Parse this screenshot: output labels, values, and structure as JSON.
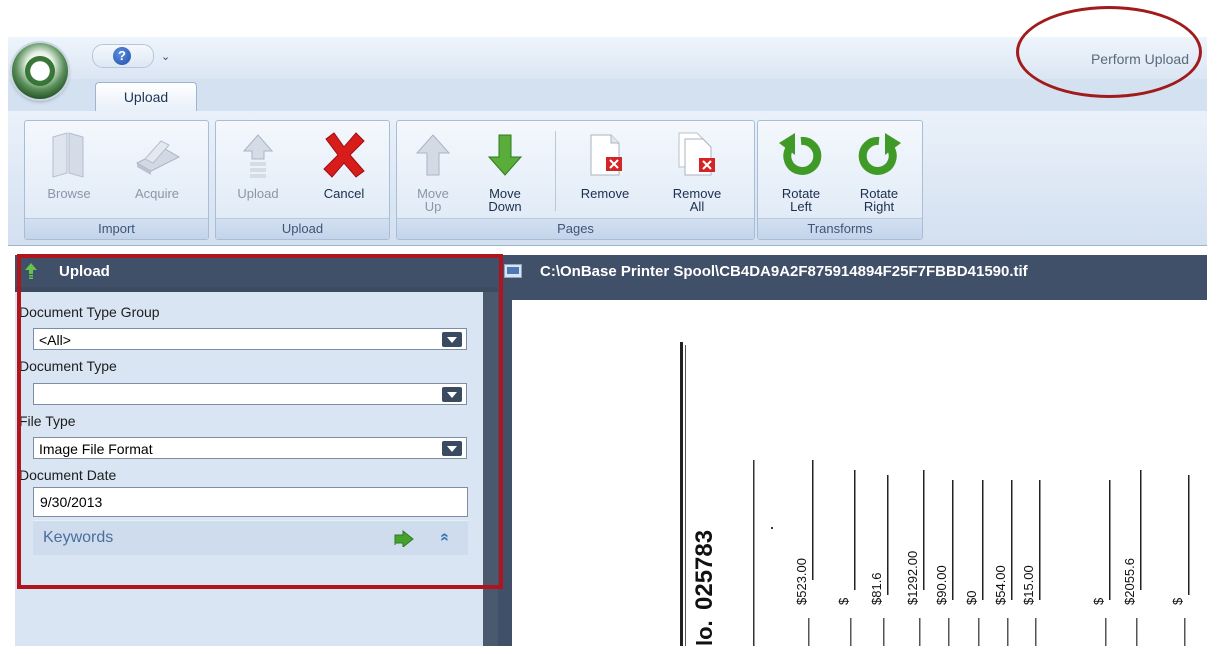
{
  "window": {
    "right_title": "Perform Upload"
  },
  "quick_access": {
    "menu_glyph": "⌄"
  },
  "tabs": [
    {
      "label": "Upload",
      "active": true
    }
  ],
  "ribbon": {
    "groups": [
      {
        "label": "Import",
        "buttons": [
          {
            "label": "Browse",
            "enabled": false,
            "icon": "browse-icon"
          },
          {
            "label": "Acquire",
            "enabled": false,
            "icon": "scanner-icon"
          }
        ]
      },
      {
        "label": "Upload",
        "buttons": [
          {
            "label": "Upload",
            "enabled": false,
            "icon": "upload-arrow-icon"
          },
          {
            "label": "Cancel",
            "enabled": true,
            "icon": "red-x-icon"
          }
        ]
      },
      {
        "label": "Pages",
        "buttons": [
          {
            "label": "Move\nUp",
            "enabled": false,
            "icon": "arrow-up-icon"
          },
          {
            "label": "Move\nDown",
            "enabled": true,
            "icon": "arrow-down-icon"
          },
          {
            "label": "Remove",
            "enabled": true,
            "icon": "remove-page-icon"
          },
          {
            "label": "Remove\nAll",
            "enabled": true,
            "icon": "remove-all-pages-icon"
          }
        ]
      },
      {
        "label": "Transforms",
        "buttons": [
          {
            "label": "Rotate\nLeft",
            "enabled": true,
            "icon": "rotate-left-icon"
          },
          {
            "label": "Rotate\nRight",
            "enabled": true,
            "icon": "rotate-right-icon"
          }
        ]
      }
    ]
  },
  "panel": {
    "title": "Upload",
    "fields": {
      "document_type_group": {
        "label": "Document Type Group",
        "value": "<All>"
      },
      "document_type": {
        "label": "Document Type",
        "value": ""
      },
      "file_type": {
        "label": "File Type",
        "value": "Image File Format"
      },
      "document_date": {
        "label": "Document Date",
        "value": "9/30/2013"
      }
    },
    "keywords": {
      "label": "Keywords",
      "collapse_glyph": "»"
    }
  },
  "document": {
    "path": "C:\\OnBase Printer Spool\\CB4DA9A2F875914894F25F7FBBD41590.tif",
    "receipt_number": "025783",
    "receipt_prefix": "lo.",
    "amounts": [
      "$523.00",
      "$",
      "$81.6",
      "$1292.00",
      "$90.00",
      "$0",
      "$54.00",
      "$15.00",
      "$",
      "$2055.6",
      "$"
    ]
  },
  "colors": {
    "annotation_red": "#b0141c",
    "panel_dark": "#3f5068",
    "panel_light": "#d9e5f3"
  }
}
